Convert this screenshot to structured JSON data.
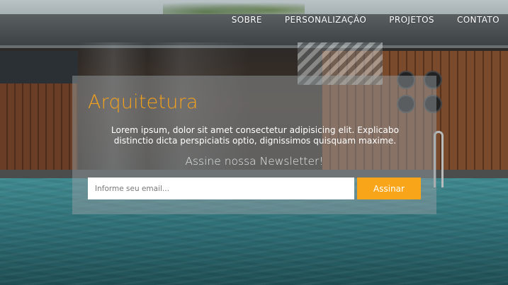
{
  "nav": {
    "items": [
      {
        "label": "SOBRE"
      },
      {
        "label": "PERSONALIZAÇÃO"
      },
      {
        "label": "PROJETOS"
      },
      {
        "label": "CONTATO"
      }
    ]
  },
  "hero": {
    "title": "Arquitetura",
    "text": "Lorem ipsum, dolor sit amet consectetur adipisicing elit. Explicabo distinctio dicta perspiciatis optio, dignissimos quisquam maxime.",
    "newsletter_heading": "Assine nossa Newsletter!",
    "email_placeholder": "Informe seu email...",
    "submit_label": "Assinar"
  },
  "colors": {
    "accent": "#f9a51a",
    "title": "#f5a21b",
    "card_overlay": "#969ea2"
  },
  "background": {
    "description_icon": "pool-architecture-photo"
  }
}
